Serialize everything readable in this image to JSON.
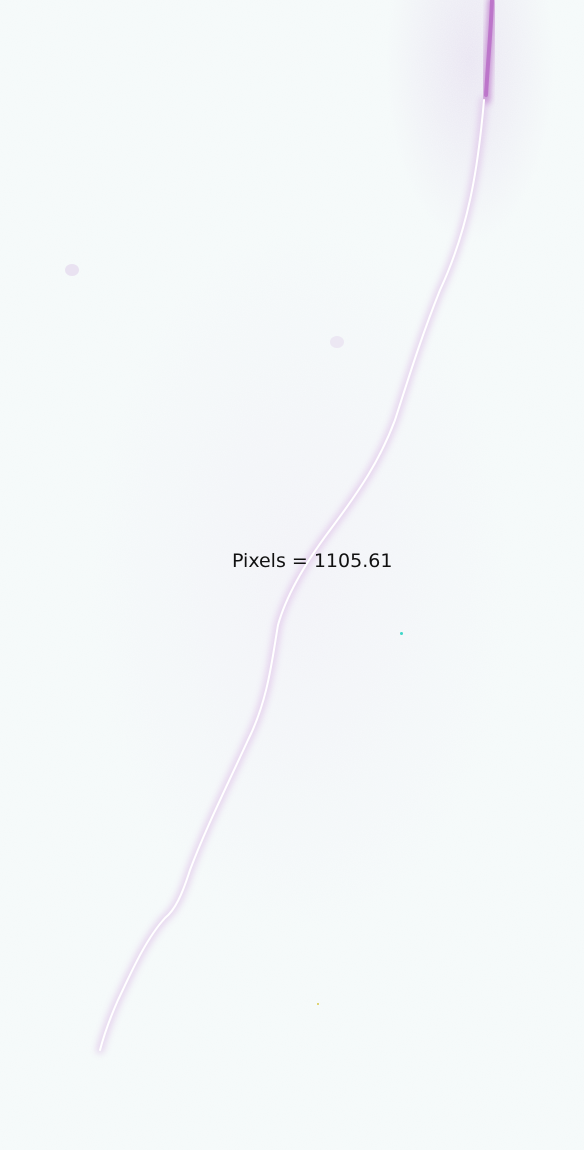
{
  "measurement": {
    "label": "Pixels = 1105.61"
  },
  "colors": {
    "background": "#f4f9f9",
    "trace_core": "#ffffff",
    "trace_glow": "#c98fd8",
    "trace_top": "#b05cc0",
    "speck_cyan": "#3fd6c8",
    "speck_yellow": "#d8c84a",
    "blob_violet": "#e6dcef"
  }
}
